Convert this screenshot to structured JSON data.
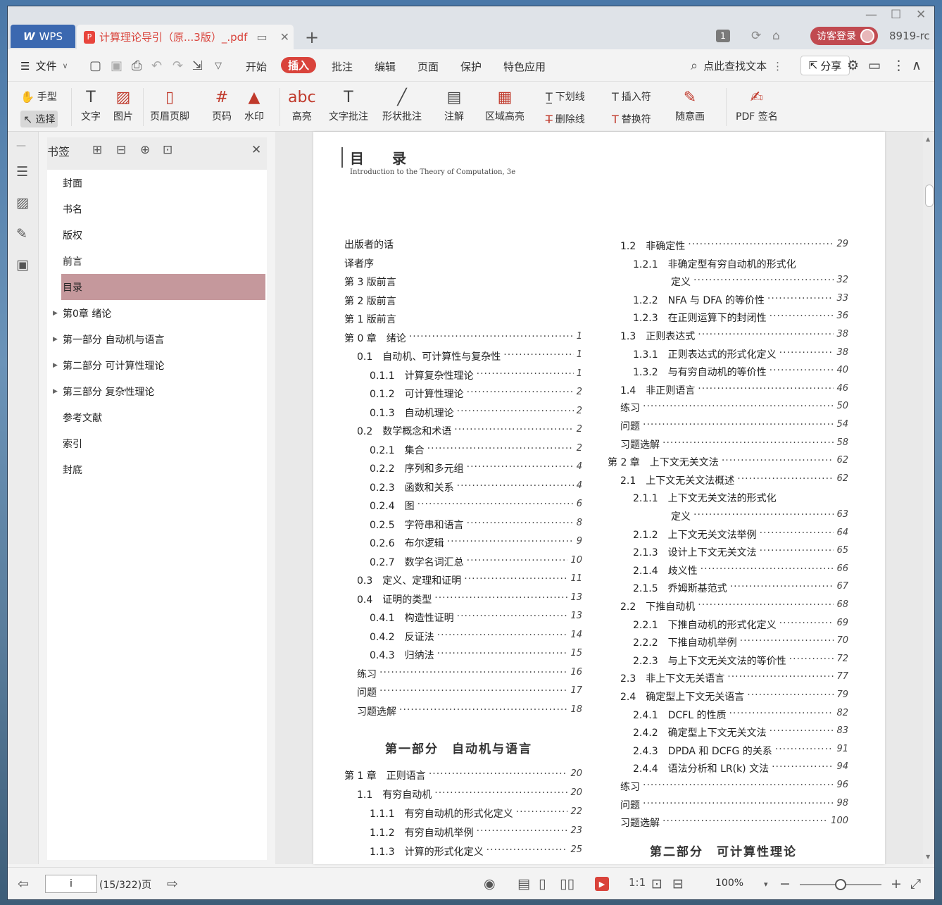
{
  "tabs": {
    "app_tab": "WPS",
    "doc_tab": "计算理论导引（原...3版）_.pdf",
    "new_tab": "+"
  },
  "titlebar": {
    "page_badge": "1",
    "login_label": "访客登录",
    "user_name": "8919-rc"
  },
  "menubar": {
    "file_label": "文件",
    "items": [
      "开始",
      "插入",
      "批注",
      "编辑",
      "页面",
      "保护",
      "特色应用"
    ],
    "active_item": "插入",
    "search_label": "点此查找文本",
    "share_label": "分享"
  },
  "ribbon": {
    "hand": "手型",
    "select": "选择",
    "text": "文字",
    "image": "图片",
    "header_footer": "页眉页脚",
    "page_no": "页码",
    "watermark": "水印",
    "highlight": "高亮",
    "text_comment": "文字批注",
    "shape_comment": "形状批注",
    "annotation": "注解",
    "area_highlight": "区域高亮",
    "underline": "下划线",
    "strikethrough": "删除线",
    "insert_mark": "插入符",
    "replace_mark": "替换符",
    "freehand": "随意画",
    "pdf_sign": "PDF 签名"
  },
  "panel": {
    "title": "书签",
    "items": [
      {
        "label": "封面",
        "expandable": false
      },
      {
        "label": "书名",
        "expandable": false
      },
      {
        "label": "版权",
        "expandable": false
      },
      {
        "label": "前言",
        "expandable": false
      },
      {
        "label": "目录",
        "expandable": false,
        "selected": true
      },
      {
        "label": "第0章  绪论",
        "expandable": true
      },
      {
        "label": "第一部分  自动机与语言",
        "expandable": true
      },
      {
        "label": "第二部分  可计算性理论",
        "expandable": true
      },
      {
        "label": "第三部分  复杂性理论",
        "expandable": true
      },
      {
        "label": "参考文献",
        "expandable": false
      },
      {
        "label": "索引",
        "expandable": false
      },
      {
        "label": "封底",
        "expandable": false
      }
    ]
  },
  "page": {
    "heading": "目　录",
    "subtitle": "Introduction to the Theory of Computation, 3e",
    "left_column": [
      {
        "t": "出版者的话",
        "p": "",
        "indent": 0
      },
      {
        "t": "译者序",
        "p": "",
        "indent": 0
      },
      {
        "t": "第 3 版前言",
        "p": "",
        "indent": 0
      },
      {
        "t": "第 2 版前言",
        "p": "",
        "indent": 0
      },
      {
        "t": "第 1 版前言",
        "p": "",
        "indent": 0
      },
      {
        "t": "第 0 章　绪论",
        "p": "1",
        "indent": 0
      },
      {
        "t": "0.1　自动机、可计算性与复杂性",
        "p": "1",
        "indent": 1
      },
      {
        "t": "0.1.1　计算复杂性理论",
        "p": "1",
        "indent": 2
      },
      {
        "t": "0.1.2　可计算性理论",
        "p": "2",
        "indent": 2
      },
      {
        "t": "0.1.3　自动机理论",
        "p": "2",
        "indent": 2
      },
      {
        "t": "0.2　数学概念和术语",
        "p": "2",
        "indent": 1
      },
      {
        "t": "0.2.1　集合",
        "p": "2",
        "indent": 2
      },
      {
        "t": "0.2.2　序列和多元组",
        "p": "4",
        "indent": 2
      },
      {
        "t": "0.2.3　函数和关系",
        "p": "4",
        "indent": 2
      },
      {
        "t": "0.2.4　图",
        "p": "6",
        "indent": 2
      },
      {
        "t": "0.2.5　字符串和语言",
        "p": "8",
        "indent": 2
      },
      {
        "t": "0.2.6　布尔逻辑",
        "p": "9",
        "indent": 2
      },
      {
        "t": "0.2.7　数学名词汇总",
        "p": "10",
        "indent": 2
      },
      {
        "t": "0.3　定义、定理和证明",
        "p": "11",
        "indent": 1
      },
      {
        "t": "0.4　证明的类型",
        "p": "13",
        "indent": 1
      },
      {
        "t": "0.4.1　构造性证明",
        "p": "13",
        "indent": 2
      },
      {
        "t": "0.4.2　反证法",
        "p": "14",
        "indent": 2
      },
      {
        "t": "0.4.3　归纳法",
        "p": "15",
        "indent": 2
      },
      {
        "t": "练习",
        "p": "16",
        "indent": 1
      },
      {
        "t": "问题",
        "p": "17",
        "indent": 1
      },
      {
        "t": "习题选解",
        "p": "18",
        "indent": 1
      }
    ],
    "left_part_title": "第一部分　自动机与语言",
    "left_column_2": [
      {
        "t": "第 1 章　正则语言",
        "p": "20",
        "indent": 0
      },
      {
        "t": "1.1　有穷自动机",
        "p": "20",
        "indent": 1
      },
      {
        "t": "1.1.1　有穷自动机的形式化定义",
        "p": "22",
        "indent": 2
      },
      {
        "t": "1.1.2　有穷自动机举例",
        "p": "23",
        "indent": 2
      },
      {
        "t": "1.1.3　计算的形式化定义",
        "p": "25",
        "indent": 2
      }
    ],
    "right_column": [
      {
        "t": "1.2　非确定性",
        "p": "29",
        "indent": 1
      },
      {
        "t": "1.2.1　非确定型有穷自动机的形式化",
        "p": "",
        "indent": 2
      },
      {
        "t": "定义",
        "p": "32",
        "indent": 3
      },
      {
        "t": "1.2.2　NFA 与 DFA 的等价性",
        "p": "33",
        "indent": 2
      },
      {
        "t": "1.2.3　在正则运算下的封闭性",
        "p": "36",
        "indent": 2
      },
      {
        "t": "1.3　正则表达式",
        "p": "38",
        "indent": 1
      },
      {
        "t": "1.3.1　正则表达式的形式化定义",
        "p": "38",
        "indent": 2
      },
      {
        "t": "1.3.2　与有穷自动机的等价性",
        "p": "40",
        "indent": 2
      },
      {
        "t": "1.4　非正则语言",
        "p": "46",
        "indent": 1
      },
      {
        "t": "练习",
        "p": "50",
        "indent": 1
      },
      {
        "t": "问题",
        "p": "54",
        "indent": 1
      },
      {
        "t": "习题选解",
        "p": "58",
        "indent": 1
      },
      {
        "t": "第 2 章　上下文无关文法",
        "p": "62",
        "indent": 0
      },
      {
        "t": "2.1　上下文无关文法概述",
        "p": "62",
        "indent": 1
      },
      {
        "t": "2.1.1　上下文无关文法的形式化",
        "p": "",
        "indent": 2
      },
      {
        "t": "定义",
        "p": "63",
        "indent": 3
      },
      {
        "t": "2.1.2　上下文无关文法举例",
        "p": "64",
        "indent": 2
      },
      {
        "t": "2.1.3　设计上下文无关文法",
        "p": "65",
        "indent": 2
      },
      {
        "t": "2.1.4　歧义性",
        "p": "66",
        "indent": 2
      },
      {
        "t": "2.1.5　乔姆斯基范式",
        "p": "67",
        "indent": 2
      },
      {
        "t": "2.2　下推自动机",
        "p": "68",
        "indent": 1
      },
      {
        "t": "2.2.1　下推自动机的形式化定义",
        "p": "69",
        "indent": 2
      },
      {
        "t": "2.2.2　下推自动机举例",
        "p": "70",
        "indent": 2
      },
      {
        "t": "2.2.3　与上下文无关文法的等价性",
        "p": "72",
        "indent": 2
      },
      {
        "t": "2.3　非上下文无关语言",
        "p": "77",
        "indent": 1
      },
      {
        "t": "2.4　确定型上下文无关语言",
        "p": "79",
        "indent": 1
      },
      {
        "t": "2.4.1　DCFL 的性质",
        "p": "82",
        "indent": 2
      },
      {
        "t": "2.4.2　确定型上下文无关文法",
        "p": "83",
        "indent": 2
      },
      {
        "t": "2.4.3　DPDA 和 DCFG 的关系",
        "p": "91",
        "indent": 2
      },
      {
        "t": "2.4.4　语法分析和 LR(k) 文法",
        "p": "94",
        "indent": 2
      },
      {
        "t": "练习",
        "p": "96",
        "indent": 1
      },
      {
        "t": "问题",
        "p": "98",
        "indent": 1
      },
      {
        "t": "习题选解",
        "p": "100",
        "indent": 1
      }
    ],
    "right_part_title": "第二部分　可计算性理论"
  },
  "status": {
    "page_input": "i",
    "page_count": "(15/322)页",
    "zoom": "100%"
  }
}
